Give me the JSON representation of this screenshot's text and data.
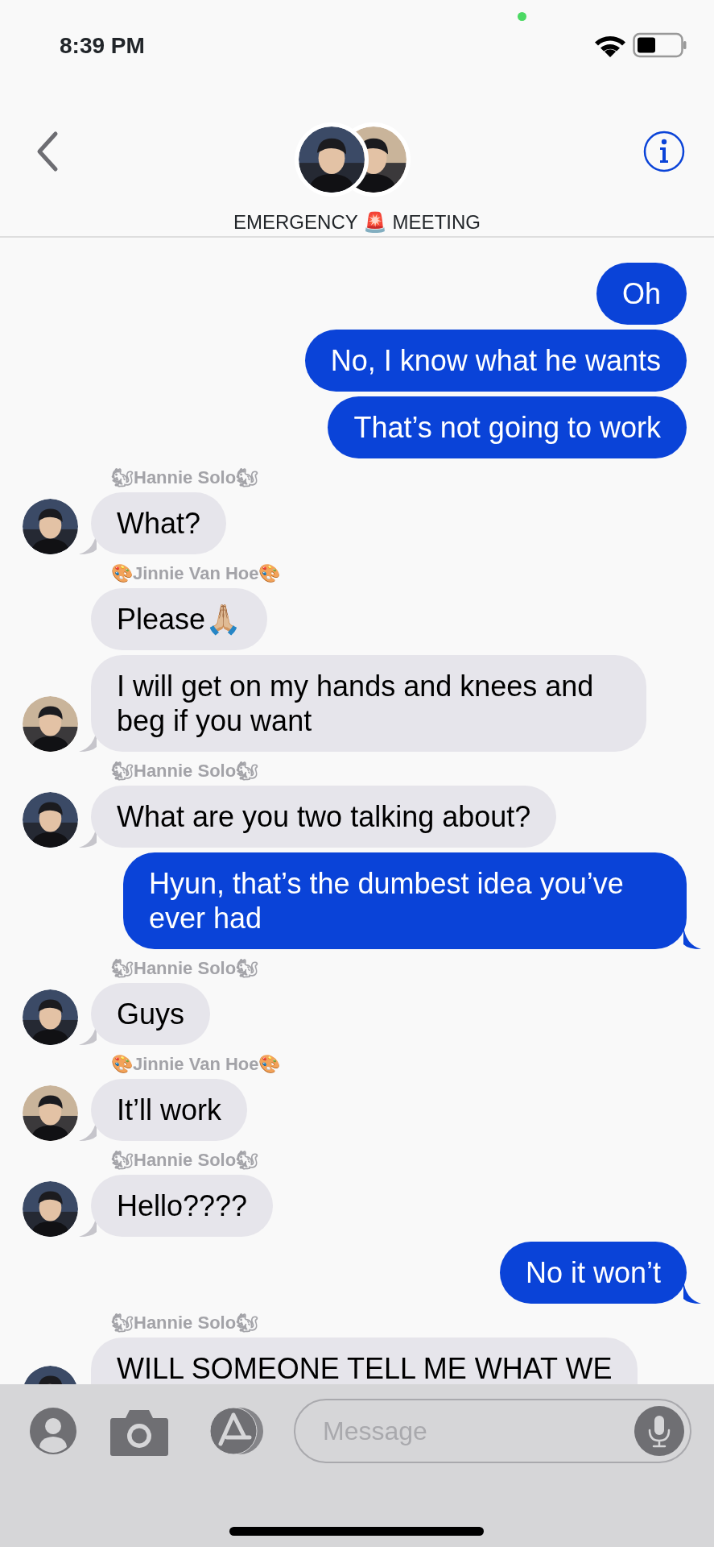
{
  "status_bar": {
    "time": "8:39 PM"
  },
  "header": {
    "title": "EMERGENCY 🚨 MEETING",
    "avatars": [
      {
        "color": "#3b4a66"
      },
      {
        "color": "#c9b49a"
      }
    ]
  },
  "messages": [
    {
      "kind": "sent",
      "text": "Oh",
      "tail": false
    },
    {
      "kind": "sent",
      "text": "No, I know what he wants",
      "tail": false
    },
    {
      "kind": "sent",
      "text": "That’s not going to work",
      "tail": false
    },
    {
      "kind": "received",
      "name": "🐿Hannie Solo🐿",
      "text": "What?",
      "tail": true,
      "avatar": {
        "color": "#3b4a66"
      }
    },
    {
      "kind": "received",
      "name": "🎨Jinnie Van Hoe🎨",
      "text": "Please🙏🏼",
      "tail": false
    },
    {
      "kind": "received",
      "text": "I will get on my hands and knees and beg if you want",
      "tail": true,
      "avatar": {
        "color": "#c9b49a"
      }
    },
    {
      "kind": "received",
      "name": "🐿Hannie Solo🐿",
      "text": "What are you two talking about?",
      "tail": true,
      "avatar": {
        "color": "#3b4a66"
      }
    },
    {
      "kind": "sent",
      "text": "Hyun, that’s the dumbest idea you’ve ever had",
      "tail": true
    },
    {
      "kind": "received",
      "name": "🐿Hannie Solo🐿",
      "text": "Guys",
      "tail": true,
      "avatar": {
        "color": "#3b4a66"
      }
    },
    {
      "kind": "received",
      "name": "🎨Jinnie Van Hoe🎨",
      "text": "It’ll work",
      "tail": true,
      "avatar": {
        "color": "#c9b49a"
      }
    },
    {
      "kind": "received",
      "name": "🐿Hannie Solo🐿",
      "text": "Hello????",
      "tail": true,
      "avatar": {
        "color": "#3b4a66"
      }
    },
    {
      "kind": "sent",
      "text": "No it won’t",
      "tail": true
    },
    {
      "kind": "received",
      "name": "🐿Hannie Solo🐿",
      "text": "WILL SOMEONE TELL ME WHAT WE",
      "tail": false,
      "avatar": {
        "color": "#3b4a66"
      }
    }
  ],
  "composer": {
    "placeholder": "Message"
  }
}
